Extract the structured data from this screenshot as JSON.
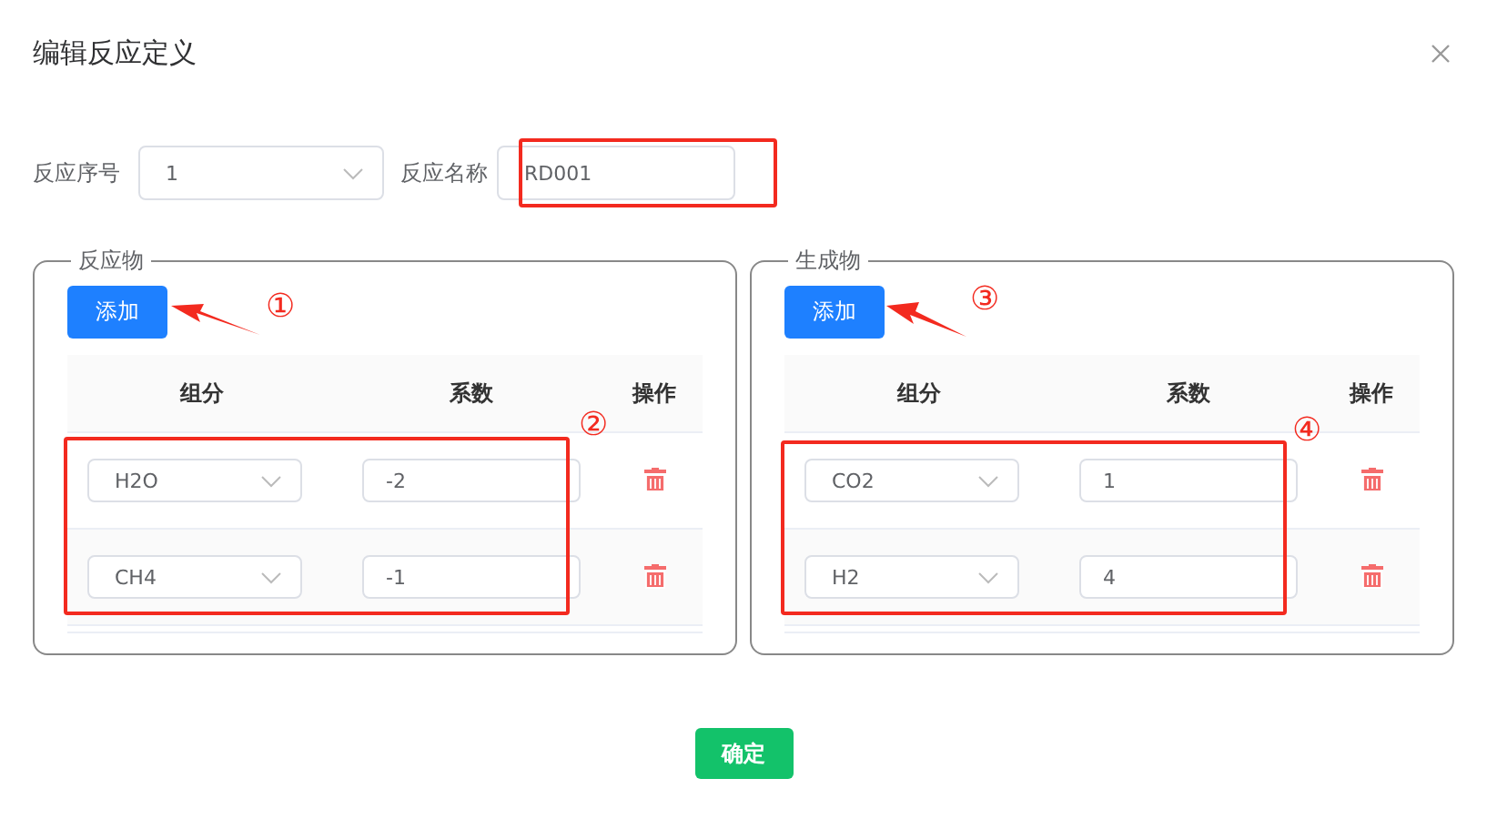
{
  "dialog": {
    "title": "编辑反应定义"
  },
  "form": {
    "index_label": "反应序号",
    "index_value": "1",
    "name_label": "反应名称",
    "name_value": "RD001"
  },
  "panels": [
    {
      "legend": "反应物",
      "add_button": "添加",
      "columns": [
        "组分",
        "系数",
        "操作"
      ],
      "rows": [
        {
          "component": "H2O",
          "coefficient": "-2"
        },
        {
          "component": "CH4",
          "coefficient": "-1"
        }
      ]
    },
    {
      "legend": "生成物",
      "add_button": "添加",
      "columns": [
        "组分",
        "系数",
        "操作"
      ],
      "rows": [
        {
          "component": "CO2",
          "coefficient": "1"
        },
        {
          "component": "H2",
          "coefficient": "4"
        }
      ]
    }
  ],
  "annotations": [
    "①",
    "②",
    "③",
    "④"
  ],
  "confirm": "确定"
}
